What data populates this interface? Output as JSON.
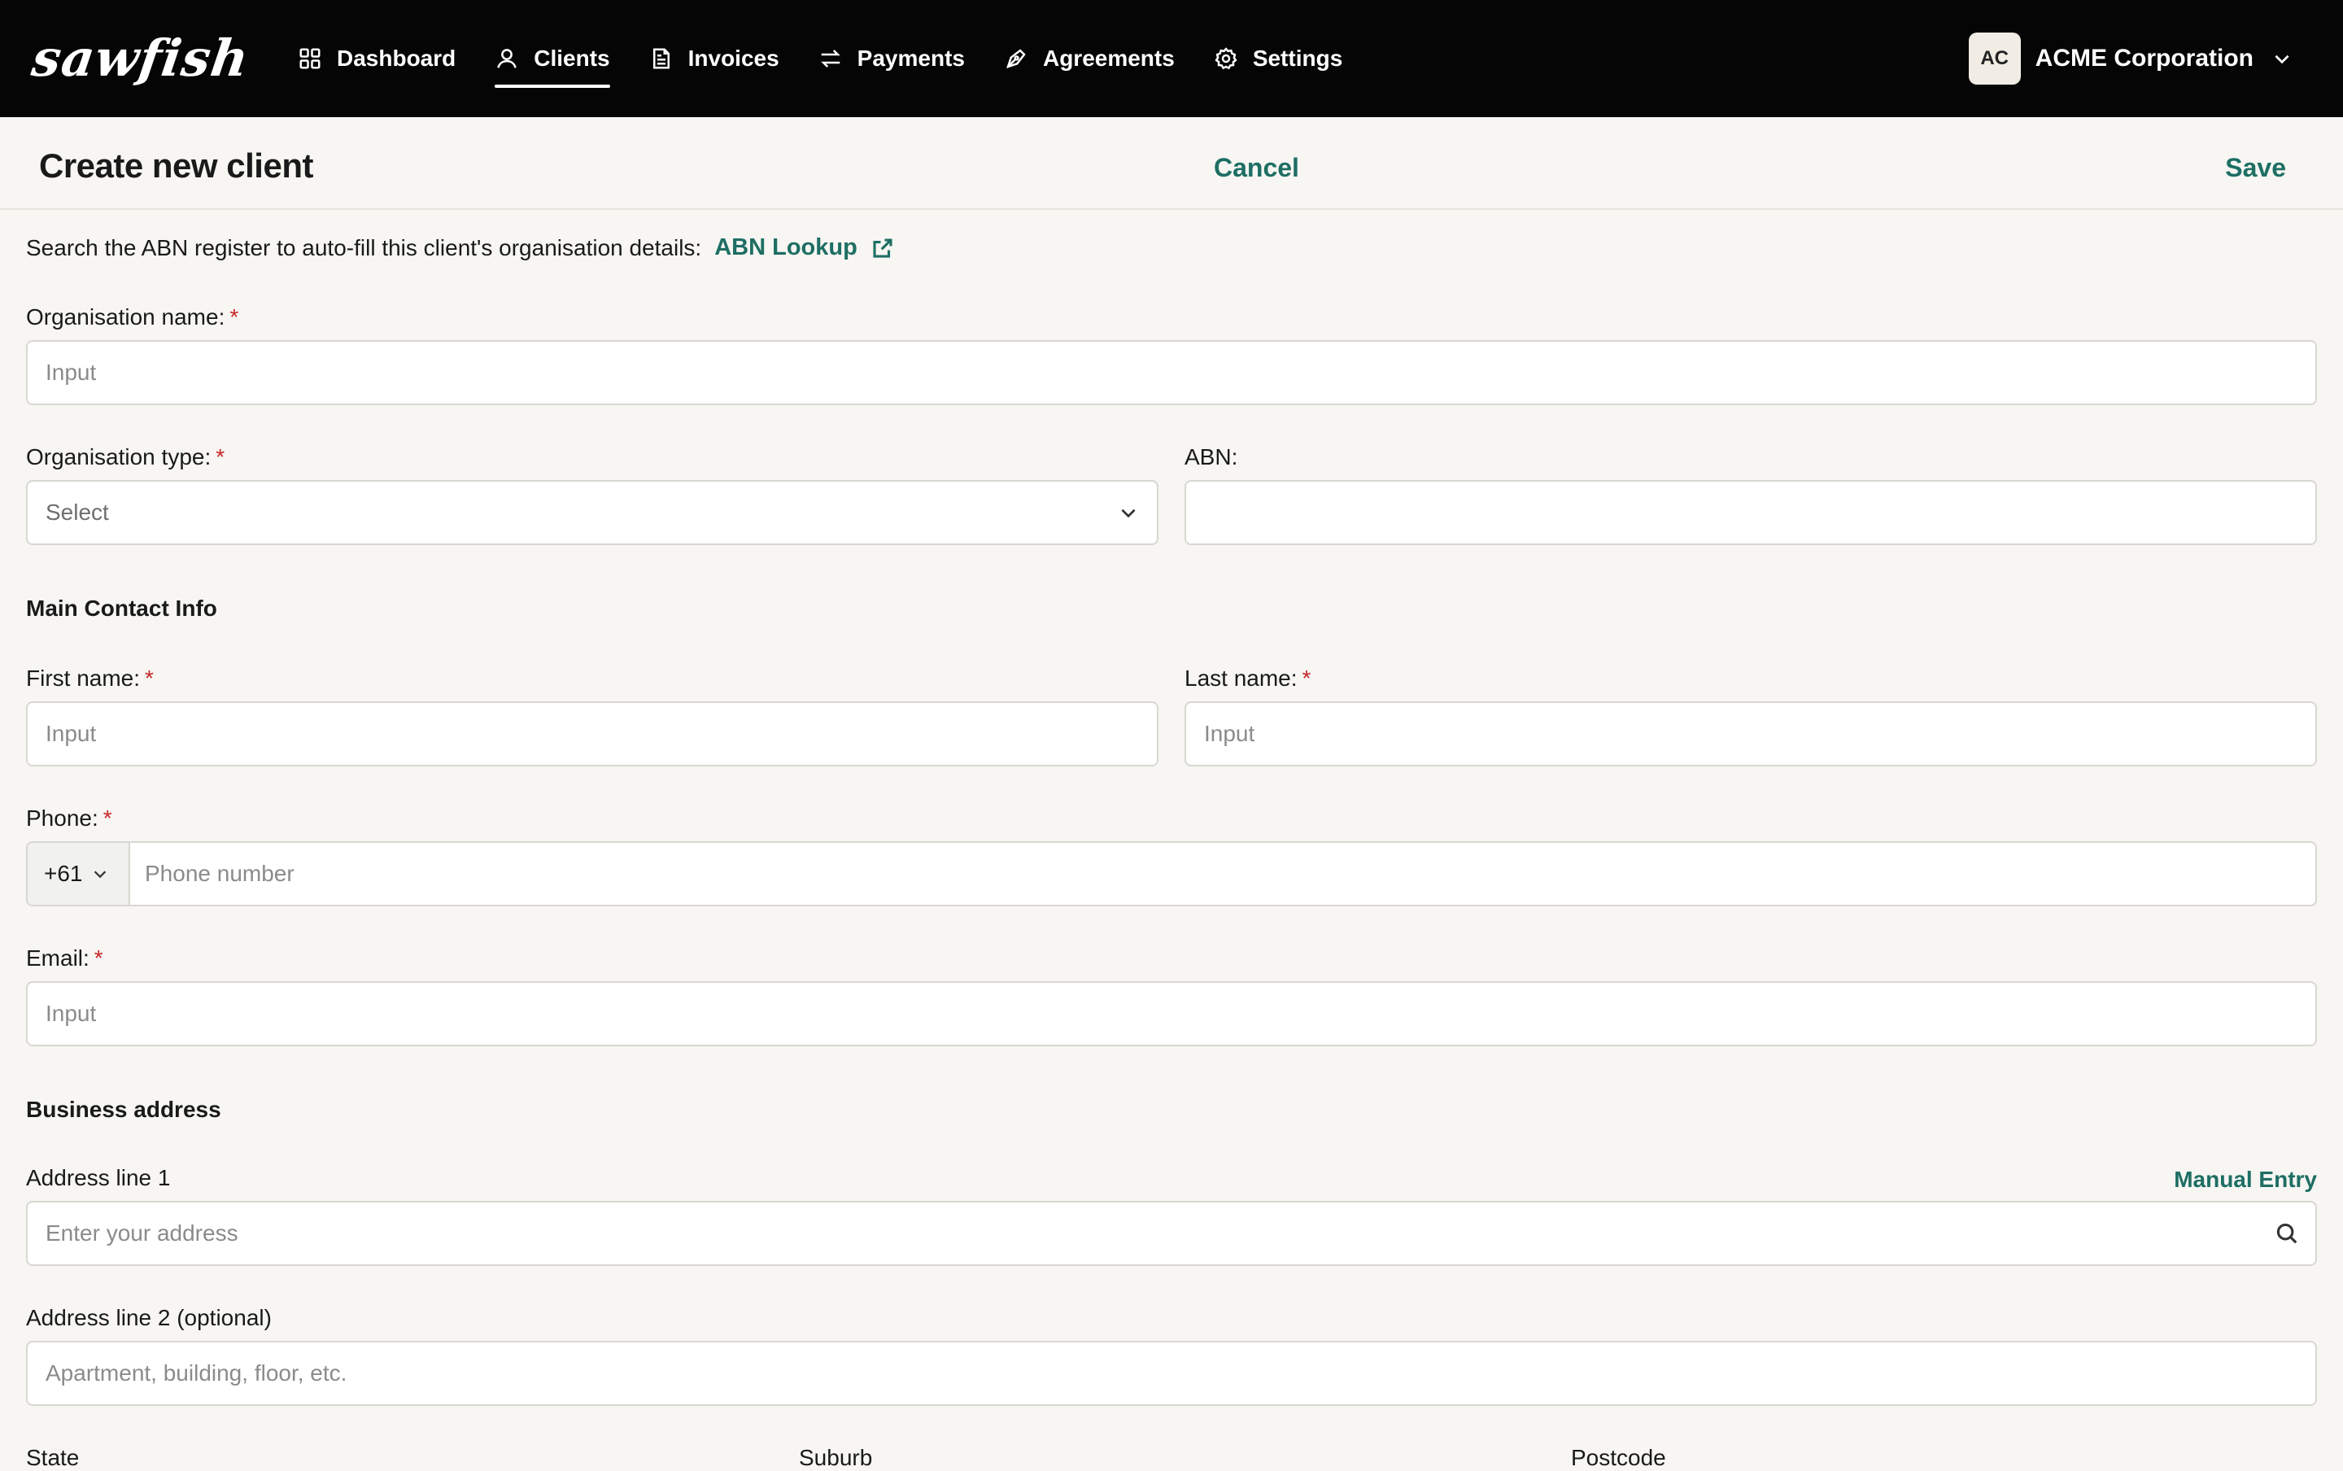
{
  "app": {
    "logo": "sawfish",
    "nav": [
      {
        "label": "Dashboard",
        "icon": "grid-icon"
      },
      {
        "label": "Clients",
        "icon": "user-icon",
        "active": true
      },
      {
        "label": "Invoices",
        "icon": "invoice-icon"
      },
      {
        "label": "Payments",
        "icon": "arrows-swap-icon"
      },
      {
        "label": "Agreements",
        "icon": "pen-icon"
      },
      {
        "label": "Settings",
        "icon": "gear-icon"
      }
    ],
    "account": {
      "initials": "AC",
      "name": "ACME Corporation"
    }
  },
  "header": {
    "title": "Create new client",
    "cancel_label": "Cancel",
    "save_label": "Save"
  },
  "form": {
    "abn_hint": "Search the ABN register to auto-fill this client's organisation details:",
    "abn_lookup_label": "ABN Lookup",
    "org_name": {
      "label": "Organisation name:",
      "placeholder": "Input",
      "value": ""
    },
    "org_type": {
      "label": "Organisation type:",
      "selected": "Select"
    },
    "abn": {
      "label": "ABN:",
      "value": ""
    },
    "main_contact_title": "Main Contact Info",
    "first_name": {
      "label": "First name:",
      "placeholder": "Input"
    },
    "last_name": {
      "label": "Last name:",
      "placeholder": "Input"
    },
    "phone": {
      "label": "Phone:",
      "country_code": "+61",
      "placeholder": "Phone number"
    },
    "email": {
      "label": "Email:",
      "placeholder": "Input"
    },
    "business_address_title": "Business address",
    "address1": {
      "label": "Address line 1",
      "placeholder": "Enter your address",
      "manual_entry_label": "Manual Entry"
    },
    "address2": {
      "label": "Address line 2 (optional)",
      "placeholder": "Apartment, building, floor, etc."
    },
    "state": {
      "label": "State"
    },
    "suburb": {
      "label": "Suburb"
    },
    "postcode": {
      "label": "Postcode"
    },
    "required_marker": "*"
  },
  "colors": {
    "accent": "#1e6e63",
    "nav_bg": "#050505",
    "page_bg": "#f7f6f3",
    "required": "#c62828"
  }
}
